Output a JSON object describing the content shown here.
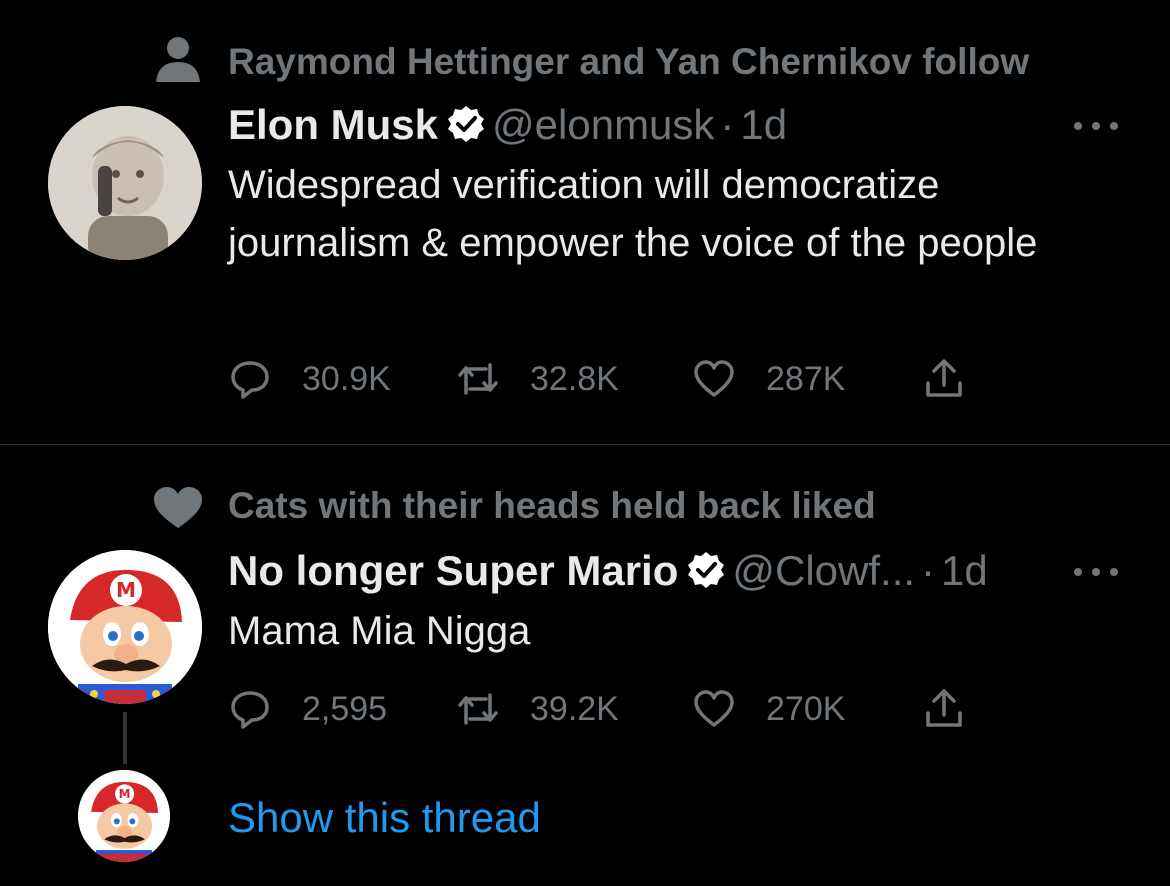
{
  "tweets": [
    {
      "context_text": "Raymond Hettinger and Yan Chernikov follow",
      "context_icon": "person-icon",
      "name": "Elon Musk",
      "verified": true,
      "handle": "@elonmusk",
      "separator": "·",
      "time": "1d",
      "text": "Widespread verification will democratize journalism & empower the voice of the people",
      "replies": "30.9K",
      "retweets": "32.8K",
      "likes": "287K"
    },
    {
      "context_text": "Cats with their heads held back liked",
      "context_icon": "heart-icon",
      "name": "No longer Super Mario",
      "verified": true,
      "handle": "@Clowf...",
      "separator": "·",
      "time": "1d",
      "text": "Mama Mia Nigga",
      "replies": "2,595",
      "retweets": "39.2K",
      "likes": "270K"
    }
  ],
  "thread": {
    "label": "Show this thread"
  },
  "colors": {
    "background": "#000000",
    "primary_text": "#e7e9ea",
    "secondary_text": "#71767b",
    "link": "#1d9bf0",
    "verified_badge": "#ffffff"
  }
}
